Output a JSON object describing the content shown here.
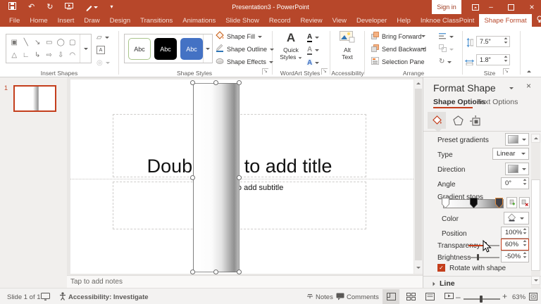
{
  "titlebar": {
    "title": "Presentation3 - PowerPoint",
    "sign_in": "Sign in"
  },
  "ribbon_tabs": [
    {
      "label": "File"
    },
    {
      "label": "Home"
    },
    {
      "label": "Insert"
    },
    {
      "label": "Draw"
    },
    {
      "label": "Design"
    },
    {
      "label": "Transitions"
    },
    {
      "label": "Animations"
    },
    {
      "label": "Slide Show"
    },
    {
      "label": "Record"
    },
    {
      "label": "Review"
    },
    {
      "label": "View"
    },
    {
      "label": "Developer"
    },
    {
      "label": "Help"
    },
    {
      "label": "Inknoe ClassPoint"
    },
    {
      "label": "Shape Format"
    }
  ],
  "tell_me": "Tell me",
  "ribbon": {
    "insert_shapes": {
      "label": "Insert Shapes",
      "glyphs": [
        "▣",
        "╲",
        "↘",
        "▭",
        "◯",
        "▢",
        "△",
        "∟",
        "↳",
        "⇨",
        "⇩",
        "◠"
      ]
    },
    "shape_styles": {
      "label": "Shape Styles",
      "presets": [
        "Abc",
        "Abc",
        "Abc"
      ],
      "fill": "Shape Fill",
      "outline": "Shape Outline",
      "effects": "Shape Effects"
    },
    "wordart": {
      "label": "WordArt Styles",
      "quick": "Quick",
      "styles": "Styles",
      "letter": "A"
    },
    "accessibility": {
      "label": "Accessibility",
      "alt": "Alt",
      "text": "Text"
    },
    "arrange": {
      "label": "Arrange",
      "bring_forward": "Bring Forward",
      "send_backward": "Send Backward",
      "selection_pane": "Selection Pane"
    },
    "size": {
      "label": "Size",
      "height": "7.5\"",
      "width": "1.8\""
    }
  },
  "slide": {
    "number": "1",
    "title_placeholder": "Double tap to add title",
    "subtitle_placeholder": "Double tap to add subtitle",
    "notes_placeholder": "Tap to add notes"
  },
  "panel": {
    "title": "Format Shape",
    "tab_shape": "Shape Options",
    "tab_text": "Text Options",
    "preset_gradients": "Preset gradients",
    "type_label": "Type",
    "type_value": "Linear",
    "direction_label": "Direction",
    "angle_label": "Angle",
    "angle_value": "0°",
    "gradient_stops_label": "Gradient stops",
    "color_label": "Color",
    "position_label": "Position",
    "position_value": "100%",
    "transparency_label": "Transparency",
    "transparency_value": "60%",
    "brightness_label": "Brightness",
    "brightness_value": "-50%",
    "rotate_label": "Rotate with shape",
    "line_label": "Line"
  },
  "statusbar": {
    "slide_count": "Slide 1 of 1",
    "accessibility": "Accessibility: Investigate",
    "notes": "Notes",
    "comments": "Comments",
    "zoom": "63%"
  },
  "colors": {
    "accent": "#B7472A",
    "selection": "#C43E1C",
    "style_blue": "#4472C4"
  }
}
